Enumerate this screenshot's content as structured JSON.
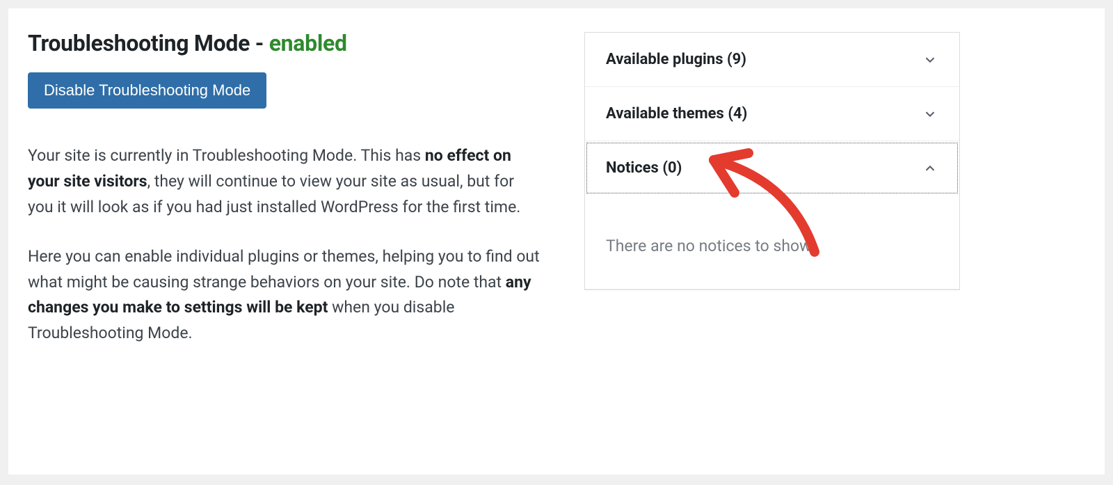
{
  "header": {
    "title_prefix": "Troubleshooting Mode - ",
    "status_label": "enabled"
  },
  "actions": {
    "disable_button_label": "Disable Troubleshooting Mode"
  },
  "description": {
    "p1_a": "Your site is currently in Troubleshooting Mode. This has ",
    "p1_strong": "no effect on your site visitors",
    "p1_b": ", they will continue to view your site as usual, but for you it will look as if you had just installed WordPress for the first time.",
    "p2_a": "Here you can enable individual plugins or themes, helping you to find out what might be causing strange behaviors on your site. Do note that ",
    "p2_strong": "any changes you make to settings will be kept",
    "p2_b": " when you disable Troubleshooting Mode."
  },
  "accordion": {
    "plugins_label": "Available plugins (9)",
    "themes_label": "Available themes (4)",
    "notices_label": "Notices (0)",
    "notices_empty_text": "There are no notices to show."
  },
  "counts": {
    "available_plugins": 9,
    "available_themes": 4,
    "notices": 0
  }
}
